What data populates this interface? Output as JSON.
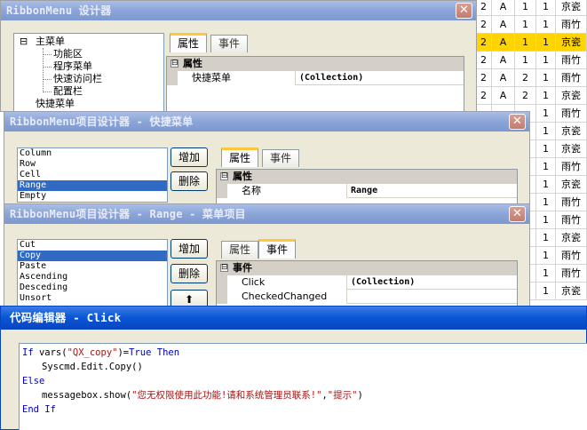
{
  "background_grid": {
    "rows": [
      {
        "c1": "2",
        "c2": "A",
        "c3": "1",
        "c4": "1",
        "c5": "京瓷",
        "selected": false
      },
      {
        "c1": "2",
        "c2": "A",
        "c3": "1",
        "c4": "1",
        "c5": "雨竹",
        "selected": false
      },
      {
        "c1": "2",
        "c2": "A",
        "c3": "1",
        "c4": "1",
        "c5": "京瓷",
        "selected": true
      },
      {
        "c1": "2",
        "c2": "A",
        "c3": "1",
        "c4": "1",
        "c5": "雨竹",
        "selected": false
      },
      {
        "c1": "2",
        "c2": "A",
        "c3": "2",
        "c4": "1",
        "c5": "雨竹",
        "selected": false
      },
      {
        "c1": "2",
        "c2": "A",
        "c3": "2",
        "c4": "1",
        "c5": "京瓷",
        "selected": false
      },
      {
        "c1": "",
        "c2": "",
        "c3": "",
        "c4": "1",
        "c5": "雨竹",
        "selected": false
      },
      {
        "c1": "",
        "c2": "",
        "c3": "",
        "c4": "1",
        "c5": "京瓷",
        "selected": false
      },
      {
        "c1": "",
        "c2": "",
        "c3": "",
        "c4": "1",
        "c5": "京瓷",
        "selected": false
      },
      {
        "c1": "",
        "c2": "",
        "c3": "",
        "c4": "1",
        "c5": "雨竹",
        "selected": false
      },
      {
        "c1": "",
        "c2": "",
        "c3": "",
        "c4": "1",
        "c5": "京瓷",
        "selected": false
      },
      {
        "c1": "",
        "c2": "",
        "c3": "",
        "c4": "1",
        "c5": "雨竹",
        "selected": false
      },
      {
        "c1": "",
        "c2": "",
        "c3": "",
        "c4": "1",
        "c5": "雨竹",
        "selected": false
      },
      {
        "c1": "",
        "c2": "",
        "c3": "",
        "c4": "1",
        "c5": "京瓷",
        "selected": false
      },
      {
        "c1": "",
        "c2": "",
        "c3": "",
        "c4": "1",
        "c5": "雨竹",
        "selected": false
      },
      {
        "c1": "",
        "c2": "",
        "c3": "",
        "c4": "1",
        "c5": "雨竹",
        "selected": false
      },
      {
        "c1": "",
        "c2": "",
        "c3": "",
        "c4": "1",
        "c5": "京瓷",
        "selected": false
      }
    ],
    "selected_color": "#ffd400"
  },
  "ribbon_designer": {
    "title": "RibbonMenu 设计器",
    "close": "✕",
    "tree": {
      "root": "主菜单",
      "root_toggle": "⊟",
      "children": [
        "功能区",
        "程序菜单",
        "快速访问栏",
        "配置栏"
      ],
      "extra": "快捷菜单"
    },
    "tabs": [
      "属性",
      "事件"
    ],
    "category": "属性",
    "category_toggle": "⊟",
    "rows": [
      {
        "name": "快捷菜单",
        "value": "(Collection)"
      }
    ]
  },
  "quick_menu_designer": {
    "title": "RibbonMenu项目设计器 - 快捷菜单",
    "close": "✕",
    "items": [
      "Column",
      "Row",
      "Cell",
      "Range",
      "Empty"
    ],
    "selected_index": 3,
    "buttons": {
      "add": "增加",
      "delete": "删除"
    },
    "tabs": [
      "属性",
      "事件"
    ],
    "category": "属性",
    "category_toggle": "⊟",
    "rows": [
      {
        "name": "名称",
        "value": "Range"
      }
    ]
  },
  "range_menu_designer": {
    "title": "RibbonMenu项目设计器 - Range - 菜单项目",
    "close": "✕",
    "items": [
      "Cut",
      "Copy",
      "Paste",
      "Ascending",
      "Desceding",
      "Unsort"
    ],
    "selected_index": 1,
    "buttons": {
      "add": "增加",
      "delete": "删除",
      "up_icon": "⬆"
    },
    "tabs": [
      "属性",
      "事件"
    ],
    "category": "事件",
    "category_toggle": "⊟",
    "rows": [
      {
        "name": "Click",
        "value": "(Collection)"
      },
      {
        "name": "CheckedChanged",
        "value": ""
      }
    ]
  },
  "code_editor": {
    "title": "代码编辑器 - Click",
    "lines": [
      {
        "indent": 0,
        "parts": [
          {
            "t": "If ",
            "k": "kw"
          },
          {
            "t": "vars(",
            "k": ""
          },
          {
            "t": "\"QX_copy\"",
            "k": "str"
          },
          {
            "t": ")=",
            "k": ""
          },
          {
            "t": "True Then",
            "k": "kw"
          }
        ]
      },
      {
        "indent": 1,
        "parts": [
          {
            "t": "Syscmd.Edit.Copy()",
            "k": ""
          }
        ]
      },
      {
        "indent": 0,
        "parts": [
          {
            "t": "Else",
            "k": "kw"
          }
        ]
      },
      {
        "indent": 1,
        "parts": [
          {
            "t": "messagebox.show(",
            "k": ""
          },
          {
            "t": "\"您无权限使用此功能!请和系统管理员联系!\"",
            "k": "str"
          },
          {
            "t": ",",
            "k": ""
          },
          {
            "t": "\"提示\"",
            "k": "str"
          },
          {
            "t": ")",
            "k": ""
          }
        ]
      },
      {
        "indent": 0,
        "parts": [
          {
            "t": "End If",
            "k": "kw"
          }
        ]
      }
    ]
  },
  "colors": {
    "active_title": "#0a57d6",
    "inactive_title": "#8ba5d8",
    "dialog_bg": "#ece9d8",
    "selection": "#316ac5",
    "keyword": "#0000c0",
    "string": "#a31515"
  }
}
